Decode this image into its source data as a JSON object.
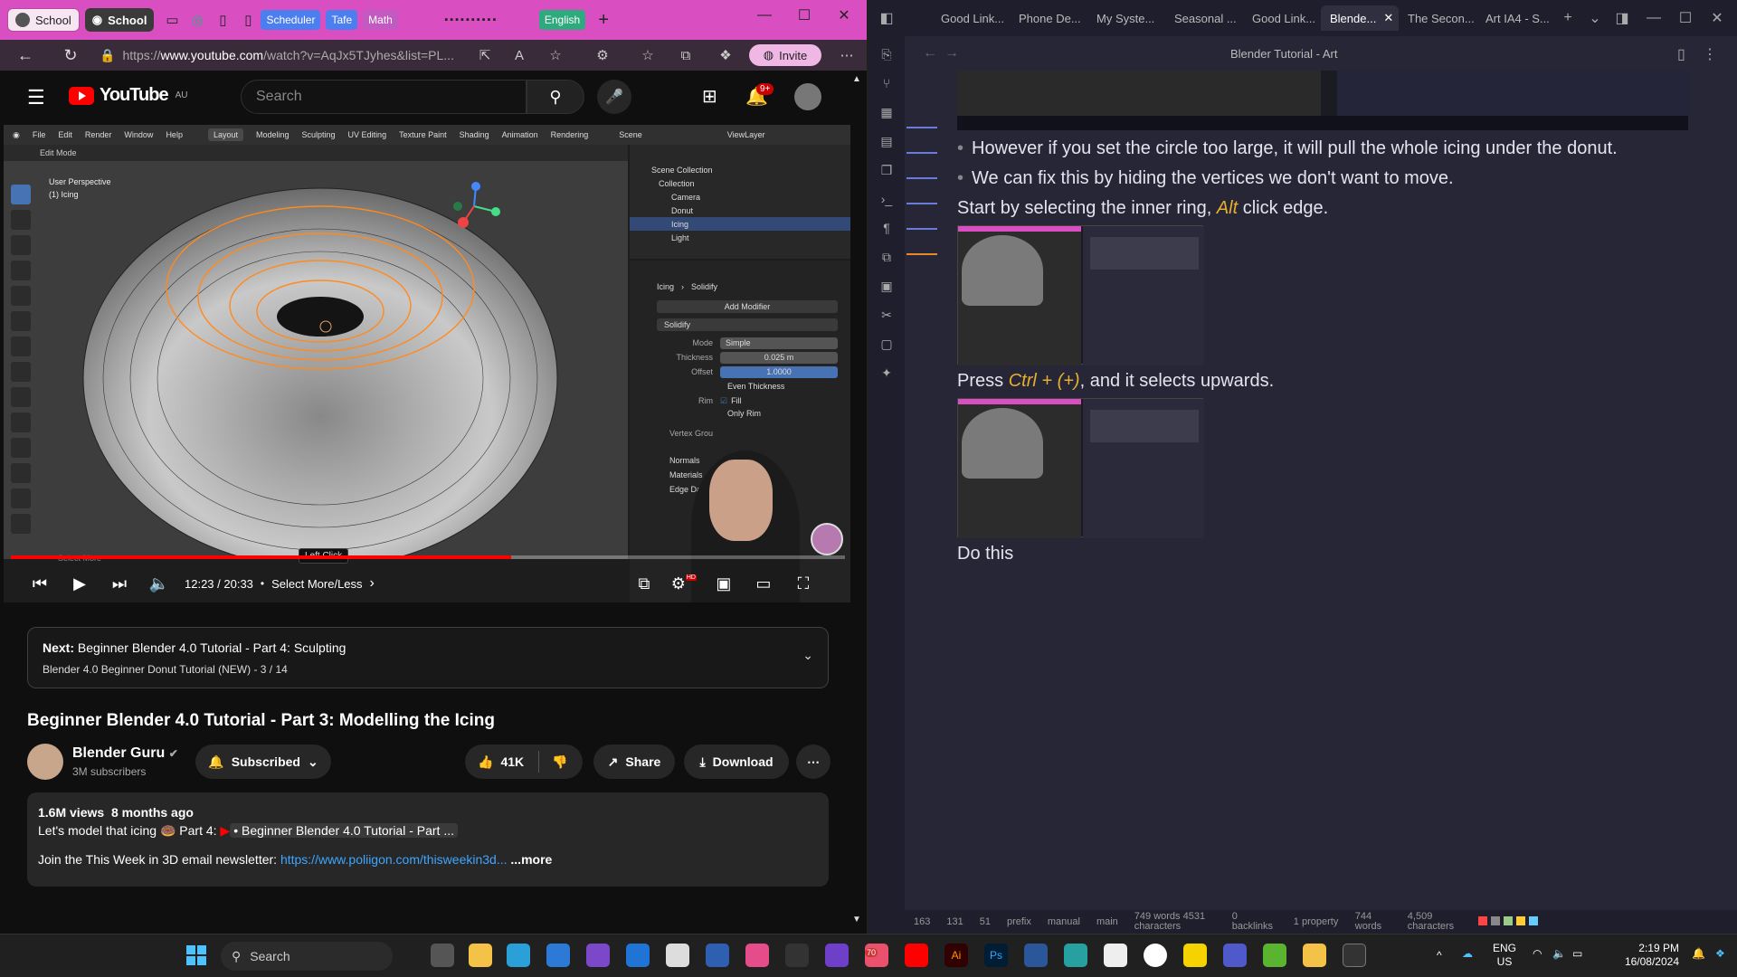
{
  "edge": {
    "profile_label": "School",
    "active_tab": "School",
    "tab_groups": [
      {
        "label": "Scheduler",
        "color": "#4c7ef0"
      },
      {
        "label": "Tafe",
        "color": "#4c7ef0"
      },
      {
        "label": "Math",
        "color": "#c25ac1"
      },
      {
        "label": "English",
        "color": "#2eaa7e"
      }
    ],
    "url_prefix": "https://",
    "url_domain": "www.youtube.com",
    "url_rest": "/watch?v=AqJx5TJyhes&list=PL...",
    "invite_label": "Invite"
  },
  "youtube": {
    "logo": "YouTube",
    "region": "AU",
    "search_placeholder": "Search",
    "notif_count": "9+",
    "video": {
      "blender_menus": [
        "File",
        "Edit",
        "Render",
        "Window",
        "Help"
      ],
      "blender_workspaces": [
        "Layout",
        "Modeling",
        "Sculpting",
        "UV Editing",
        "Texture Paint",
        "Shading",
        "Animation",
        "Rendering"
      ],
      "scene_label": "Scene",
      "viewlayer_label": "ViewLayer",
      "mode_label": "Edit Mode",
      "vp_info_1": "User Perspective",
      "vp_info_2": "(1) Icing",
      "outliner": [
        {
          "label": "Scene Collection",
          "sel": false
        },
        {
          "label": "Collection",
          "sel": false
        },
        {
          "label": "Camera",
          "sel": false
        },
        {
          "label": "Donut",
          "sel": false
        },
        {
          "label": "Icing",
          "sel": true
        },
        {
          "label": "Light",
          "sel": false
        }
      ],
      "props_object": "Icing",
      "props_modifier": "Solidify",
      "add_modifier": "Add Modifier",
      "mode_field_label": "Mode",
      "mode_field_value": "Simple",
      "thickness_label": "Thickness",
      "thickness_value": "0.025 m",
      "offset_label": "Offset",
      "offset_value": "1.0000",
      "even_thickness": "Even Thickness",
      "rim_label": "Rim",
      "rim_fill": "Fill",
      "only_rim": "Only Rim",
      "vertex_group": "Vertex Grou",
      "sections": [
        "Normals",
        "Materials",
        "Edge Data"
      ],
      "tooltip": "Left Click",
      "status_hint": "Select More",
      "progress": 0.6,
      "time": "12:23 / 20:33",
      "chapter": "Select More/Less",
      "hd": "HD"
    },
    "next_label": "Next:",
    "next_title": "Beginner Blender 4.0 Tutorial - Part 4: Sculpting",
    "next_sub": "Blender 4.0 Beginner Donut Tutorial (NEW) - 3 / 14",
    "title": "Beginner Blender 4.0 Tutorial - Part 3: Modelling the Icing",
    "channel": "Blender Guru",
    "subs": "3M subscribers",
    "subscribed": "Subscribed",
    "likes": "41K",
    "share": "Share",
    "download": "Download",
    "views": "1.6M views",
    "age": "8 months ago",
    "desc_line1": "Let's model that icing 🍩 Part 4:",
    "desc_link1": "• Beginner Blender 4.0 Tutorial - Part ...",
    "desc_line2": "Join the This Week in 3D email newsletter:",
    "desc_link2": "https://www.poliigon.com/thisweekin3d...",
    "more": "...more"
  },
  "obsidian": {
    "tabs": [
      "Good Link...",
      "Phone De...",
      "My Syste...",
      "Seasonal ...",
      "Good Link...",
      "Blende...",
      "The Secon...",
      "Art IA4 - S..."
    ],
    "active_tab_index": 5,
    "title": "Blender Tutorial - Art",
    "bullet1": "However if you set the circle too large, it will pull the whole icing under the donut.",
    "bullet2": "We can fix this by hiding the vertices we don't want to move.",
    "line3_pre": "Start by selecting the inner ring,",
    "line3_key": "Alt",
    "line3_post": "click edge.",
    "line4_pre": "Press",
    "line4_key": "Ctrl + (+)",
    "line4_post": ", and it selects upwards.",
    "line5": "Do this",
    "status": {
      "backlinks_count": "163",
      "count2": "131",
      "count3": "51",
      "prefix": "prefix",
      "manual": "manual",
      "branch": "main",
      "words_chars": "749 words 4531 characters",
      "backlinks": "0 backlinks",
      "property": "1 property",
      "words": "744 words",
      "characters": "4,509 characters"
    }
  },
  "taskbar": {
    "search_label": "Search",
    "lang1": "ENG",
    "lang2": "US",
    "time": "2:19 PM",
    "date": "16/08/2024",
    "badge": "70"
  }
}
